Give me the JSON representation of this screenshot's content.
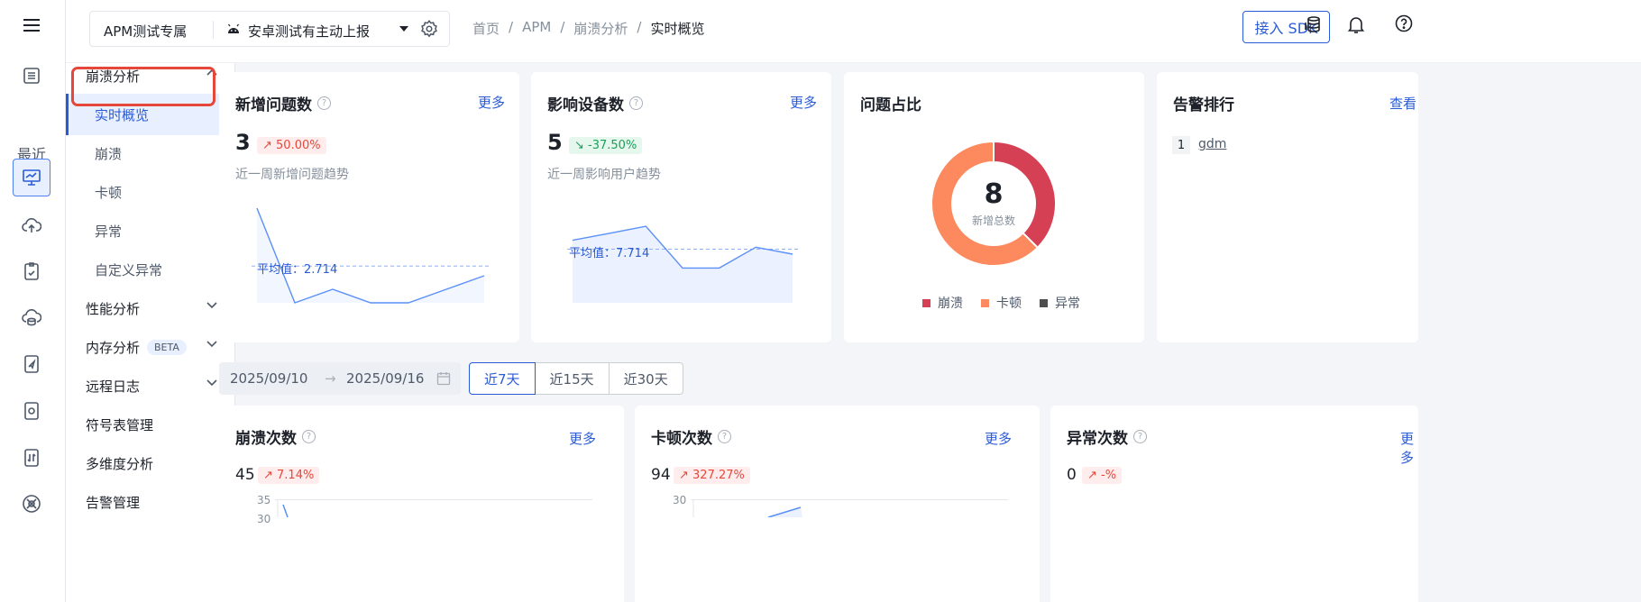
{
  "rail": {
    "recent_label": "最近"
  },
  "topbar": {
    "project_name": "APM测试专属",
    "app_name": "安卓测试有主动上报",
    "breadcrumbs": [
      "首页",
      "APM",
      "崩溃分析",
      "实时概览"
    ],
    "sdk_button": "接入 SDK"
  },
  "subnav": {
    "group_crash": "崩溃分析",
    "children": [
      "实时概览",
      "崩溃",
      "卡顿",
      "异常",
      "自定义异常"
    ],
    "perf": "性能分析",
    "memory": "内存分析",
    "memory_badge": "BETA",
    "remote_log": "远程日志",
    "symbols": "符号表管理",
    "multidim": "多维度分析",
    "alerts": "告警管理"
  },
  "cards": {
    "new_issues": {
      "title": "新增问题数",
      "more": "更多",
      "value": "3",
      "change": "50.00%",
      "subtitle": "近一周新增问题趋势",
      "avg_label": "平均值：2.714"
    },
    "devices": {
      "title": "影响设备数",
      "more": "更多",
      "value": "5",
      "change": "-37.50%",
      "subtitle": "近一周影响用户趋势",
      "avg_label": "平均值：7.714"
    },
    "ratio": {
      "title": "问题占比",
      "total": "8",
      "total_label": "新增总数",
      "legend": [
        "崩溃",
        "卡顿",
        "异常"
      ]
    },
    "alerts": {
      "title": "告警排行",
      "more": "查看",
      "rank": "1",
      "name": "gdm"
    },
    "crash_count": {
      "title": "崩溃次数",
      "more": "更多",
      "value": "45",
      "change": "7.14%",
      "y_top": "35",
      "y_second": "30"
    },
    "lag_count": {
      "title": "卡顿次数",
      "more": "更多",
      "value": "94",
      "change": "327.27%",
      "y_top": "30"
    },
    "exception_count": {
      "title": "异常次数",
      "more": "更多",
      "value": "0",
      "change": "-%"
    }
  },
  "daterange": {
    "start": "2025/09/10",
    "end": "2025/09/16"
  },
  "range_buttons": [
    "近7天",
    "近15天",
    "近30天"
  ],
  "colors": {
    "accent": "#2a5bd7",
    "crash": "#d64054",
    "lag": "#fc8a5e",
    "exception": "#4e4e4e",
    "up": "#e5483a",
    "down": "#1aa05a"
  },
  "chart_data": [
    {
      "type": "line",
      "title": "近一周新增问题趋势",
      "values": [
        7,
        0,
        1,
        0,
        0,
        1,
        2
      ],
      "average": 2.714,
      "ylim": [
        0,
        7.2
      ]
    },
    {
      "type": "area",
      "title": "近一周影响用户趋势",
      "values": [
        9,
        10,
        11,
        5,
        5,
        8,
        7
      ],
      "average": 7.714,
      "ylim": [
        0,
        14
      ]
    },
    {
      "type": "pie",
      "title": "问题占比",
      "categories": [
        "崩溃",
        "卡顿",
        "异常"
      ],
      "values": [
        3,
        5,
        0
      ]
    },
    {
      "type": "line",
      "title": "崩溃次数",
      "ylim_top": 35,
      "y_ticks": [
        35,
        30
      ]
    },
    {
      "type": "line",
      "title": "卡顿次数",
      "ylim_top": 30,
      "y_ticks": [
        30
      ]
    }
  ]
}
